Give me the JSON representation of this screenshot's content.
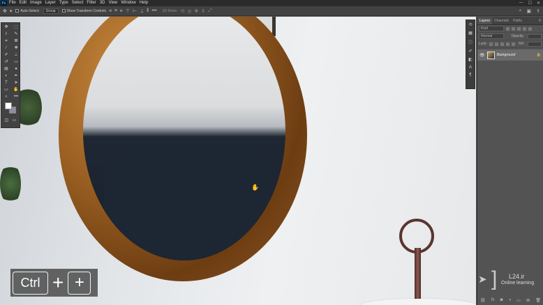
{
  "app": {
    "logo": "Ps"
  },
  "menu": [
    "File",
    "Edit",
    "Image",
    "Layer",
    "Type",
    "Select",
    "Filter",
    "3D",
    "View",
    "Window",
    "Help"
  ],
  "options": {
    "auto_select_label": "Auto-Select:",
    "auto_select_value": "Group",
    "show_transform_label": "Show Transform Controls",
    "mode_3d": "3D Mode:"
  },
  "panel": {
    "tabs": [
      "Layers",
      "Channels",
      "Paths"
    ],
    "kind_label": "Kind",
    "blend_mode": "Normal",
    "opacity_label": "Opacity:",
    "lock_label": "Lock:",
    "fill_label": "Fill:",
    "layer_name": "Background"
  },
  "shortcut": {
    "key1": "Ctrl",
    "sep": "+",
    "key2": "+"
  },
  "watermark": {
    "name": "L24.ir",
    "tagline": "Online learning"
  },
  "colors": {
    "foreground": "#ffffff",
    "background": "#8e8ea6",
    "app_bg": "#535353"
  }
}
